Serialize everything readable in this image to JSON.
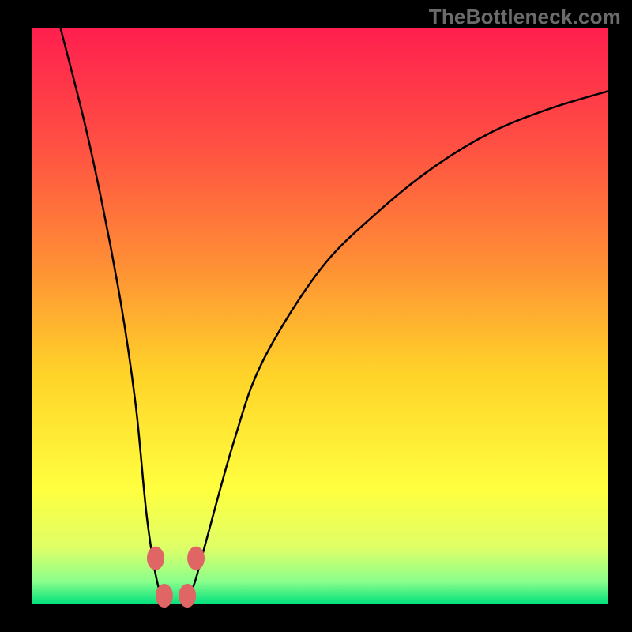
{
  "watermark": "TheBottleneck.com",
  "chart_data": {
    "type": "line",
    "title": "",
    "xlabel": "",
    "ylabel": "",
    "xlim": [
      0,
      100
    ],
    "ylim": [
      0,
      100
    ],
    "grid": false,
    "legend": false,
    "series": [
      {
        "name": "bottleneck-curve",
        "x": [
          5,
          10,
          15,
          18,
          20,
          22,
          24,
          26,
          28,
          30,
          35,
          40,
          50,
          60,
          70,
          80,
          90,
          100
        ],
        "values": [
          100,
          80,
          55,
          35,
          15,
          3,
          0,
          0,
          3,
          10,
          28,
          42,
          58,
          68,
          76,
          82,
          86,
          89
        ]
      }
    ],
    "markers": [
      {
        "x": 21.5,
        "y": 8
      },
      {
        "x": 28.5,
        "y": 8
      },
      {
        "x": 23.0,
        "y": 1.5
      },
      {
        "x": 27.0,
        "y": 1.5
      }
    ],
    "background_gradient": {
      "top": "#ff1f4f",
      "upper_mid": "#ff8b36",
      "mid": "#ffd329",
      "lower_mid": "#ffff3f",
      "bottom": "#00e07c"
    },
    "curve_color": "#000000",
    "marker_color": "#e06666"
  }
}
